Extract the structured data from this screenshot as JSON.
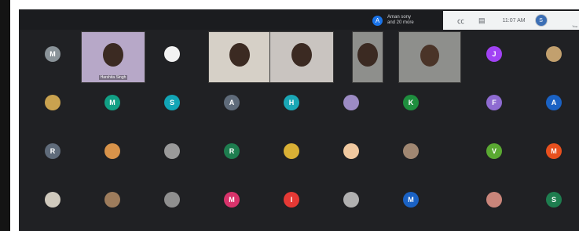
{
  "notification": {
    "avatar_letter": "A",
    "line1": "Aman sony",
    "line2": "and 20 more"
  },
  "toolbar": {
    "captions_icon": "cc-icon",
    "chat_icon": "chat-icon",
    "time": "11:07 AM",
    "self_letter": "S",
    "self_tag": "You"
  },
  "participants": [
    {
      "row": 0,
      "col": 0,
      "letter": "M",
      "color": "#8a9399"
    },
    {
      "row": 0,
      "col": 1,
      "video": true,
      "label": "Harshita Singh",
      "bg": "#b7a8c8"
    },
    {
      "row": 0,
      "col": 2,
      "letter": "",
      "color": "#f2f2f2"
    },
    {
      "row": 0,
      "col": 3,
      "video": true,
      "label": "",
      "bg": "#d6d0c7"
    },
    {
      "row": 0,
      "col": 5,
      "video": true,
      "label": "",
      "bg": "#c9c4c0"
    },
    {
      "row": 0,
      "col": 6,
      "video": true,
      "label": "",
      "bg": "#8e8f8c"
    },
    {
      "row": 0,
      "col": 7,
      "letter": "J",
      "color": "#a142f4"
    },
    {
      "row": 0,
      "col": 8,
      "letter": "",
      "color": "#c2a06e"
    },
    {
      "row": 1,
      "col": 0,
      "letter": "",
      "color": "#c9a24f"
    },
    {
      "row": 1,
      "col": 1,
      "letter": "M",
      "color": "#12a085"
    },
    {
      "row": 1,
      "col": 2,
      "letter": "S",
      "color": "#12a5b6"
    },
    {
      "row": 1,
      "col": 3,
      "letter": "A",
      "color": "#5f6b7a"
    },
    {
      "row": 1,
      "col": 4,
      "letter": "H",
      "color": "#1aa7b6"
    },
    {
      "row": 1,
      "col": 5,
      "letter": "",
      "color": "#9c8bc4"
    },
    {
      "row": 1,
      "col": 6,
      "letter": "K",
      "color": "#1e8e3e"
    },
    {
      "row": 1,
      "col": 7,
      "letter": "F",
      "color": "#8e6bd1"
    },
    {
      "row": 1,
      "col": 8,
      "letter": "A",
      "color": "#1a62c4"
    },
    {
      "row": 2,
      "col": 0,
      "letter": "R",
      "color": "#5f6b7a"
    },
    {
      "row": 2,
      "col": 1,
      "letter": "",
      "color": "#d8934a"
    },
    {
      "row": 2,
      "col": 2,
      "letter": "",
      "color": "#9a9a9a"
    },
    {
      "row": 2,
      "col": 3,
      "letter": "R",
      "color": "#1e7d4f"
    },
    {
      "row": 2,
      "col": 4,
      "letter": "",
      "color": "#d9b035"
    },
    {
      "row": 2,
      "col": 5,
      "letter": "",
      "color": "#f0c9a0"
    },
    {
      "row": 2,
      "col": 6,
      "letter": "",
      "color": "#a08772"
    },
    {
      "row": 2,
      "col": 7,
      "letter": "V",
      "color": "#5aa932"
    },
    {
      "row": 2,
      "col": 8,
      "letter": "M",
      "color": "#e8501e"
    },
    {
      "row": 3,
      "col": 0,
      "letter": "",
      "color": "#cfc9bd"
    },
    {
      "row": 3,
      "col": 1,
      "letter": "",
      "color": "#9d7c5c"
    },
    {
      "row": 3,
      "col": 2,
      "letter": "",
      "color": "#8f8f8f"
    },
    {
      "row": 3,
      "col": 3,
      "letter": "M",
      "color": "#d8336b"
    },
    {
      "row": 3,
      "col": 4,
      "letter": "I",
      "color": "#e53935"
    },
    {
      "row": 3,
      "col": 5,
      "letter": "",
      "color": "#b0b0b0"
    },
    {
      "row": 3,
      "col": 6,
      "letter": "M",
      "color": "#1a62c4"
    },
    {
      "row": 3,
      "col": 7,
      "letter": "",
      "color": "#c9857a"
    },
    {
      "row": 3,
      "col": 8,
      "letter": "S",
      "color": "#1e7d4f"
    }
  ]
}
